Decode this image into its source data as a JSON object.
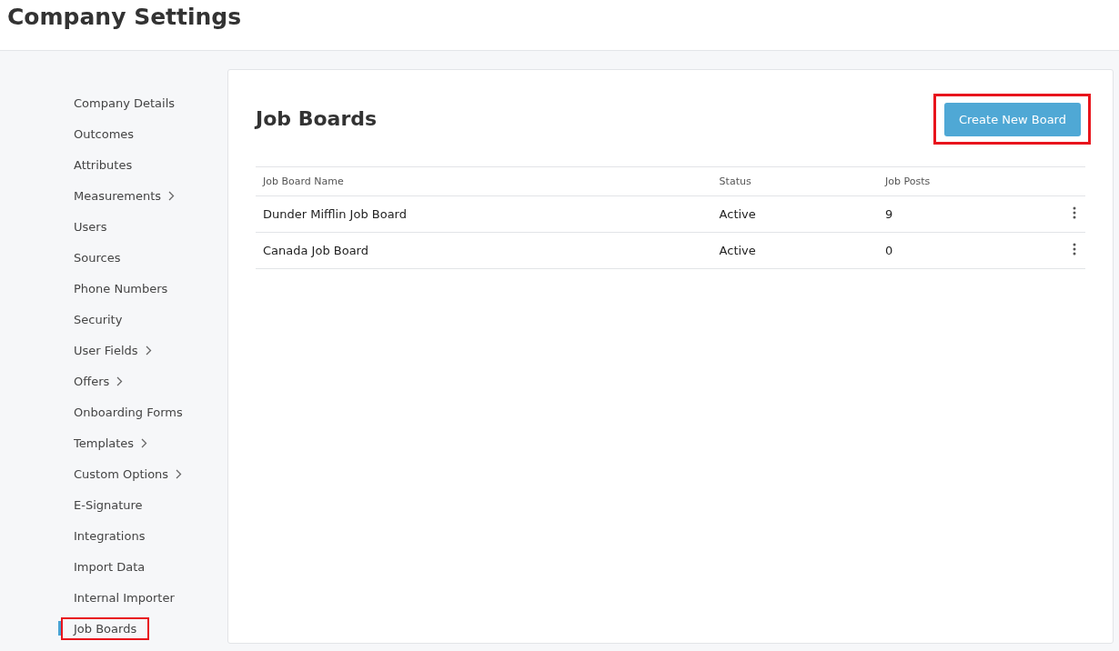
{
  "page_title": "Company Settings",
  "sidebar": {
    "items": [
      {
        "label": "Company Details",
        "has_submenu": false,
        "selected": false,
        "highlighted": false
      },
      {
        "label": "Outcomes",
        "has_submenu": false,
        "selected": false,
        "highlighted": false
      },
      {
        "label": "Attributes",
        "has_submenu": false,
        "selected": false,
        "highlighted": false
      },
      {
        "label": "Measurements",
        "has_submenu": true,
        "selected": false,
        "highlighted": false
      },
      {
        "label": "Users",
        "has_submenu": false,
        "selected": false,
        "highlighted": false
      },
      {
        "label": "Sources",
        "has_submenu": false,
        "selected": false,
        "highlighted": false
      },
      {
        "label": "Phone Numbers",
        "has_submenu": false,
        "selected": false,
        "highlighted": false
      },
      {
        "label": "Security",
        "has_submenu": false,
        "selected": false,
        "highlighted": false
      },
      {
        "label": "User Fields",
        "has_submenu": true,
        "selected": false,
        "highlighted": false
      },
      {
        "label": "Offers",
        "has_submenu": true,
        "selected": false,
        "highlighted": false
      },
      {
        "label": "Onboarding Forms",
        "has_submenu": false,
        "selected": false,
        "highlighted": false
      },
      {
        "label": "Templates",
        "has_submenu": true,
        "selected": false,
        "highlighted": false
      },
      {
        "label": "Custom Options",
        "has_submenu": true,
        "selected": false,
        "highlighted": false
      },
      {
        "label": "E-Signature",
        "has_submenu": false,
        "selected": false,
        "highlighted": false
      },
      {
        "label": "Integrations",
        "has_submenu": false,
        "selected": false,
        "highlighted": false
      },
      {
        "label": "Import Data",
        "has_submenu": false,
        "selected": false,
        "highlighted": false
      },
      {
        "label": "Internal Importer",
        "has_submenu": false,
        "selected": false,
        "highlighted": false
      },
      {
        "label": "Job Boards",
        "has_submenu": false,
        "selected": true,
        "highlighted": true
      }
    ]
  },
  "panel": {
    "title": "Job Boards",
    "create_button": {
      "label": "Create New Board",
      "highlighted": true
    },
    "table": {
      "columns": [
        "Job Board Name",
        "Status",
        "Job Posts"
      ],
      "rows": [
        {
          "name": "Dunder Mifflin Job Board",
          "status": "Active",
          "job_posts": "9"
        },
        {
          "name": "Canada Job Board",
          "status": "Active",
          "job_posts": "0"
        }
      ]
    }
  }
}
